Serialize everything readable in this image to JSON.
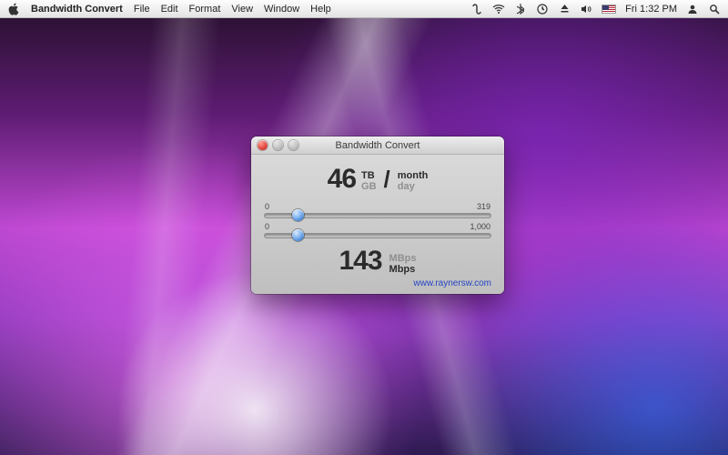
{
  "menubar": {
    "app_name": "Bandwidth Convert",
    "items": [
      "File",
      "Edit",
      "Format",
      "View",
      "Window",
      "Help"
    ],
    "clock": "Fri 1:32 PM"
  },
  "window": {
    "title": "Bandwidth Convert",
    "readout_top": {
      "value": "46",
      "unit_primary": "TB",
      "unit_secondary": "GB",
      "per": "/",
      "period_primary": "month",
      "period_secondary": "day"
    },
    "slider_top": {
      "min_label": "0",
      "max_label": "319",
      "position_pct": 15
    },
    "slider_bottom": {
      "min_label": "0",
      "max_label": "1,000",
      "position_pct": 15
    },
    "readout_bottom": {
      "value": "143",
      "unit_primary": "MBps",
      "unit_secondary": "Mbps"
    },
    "footer_link": "www.raynersw.com"
  }
}
